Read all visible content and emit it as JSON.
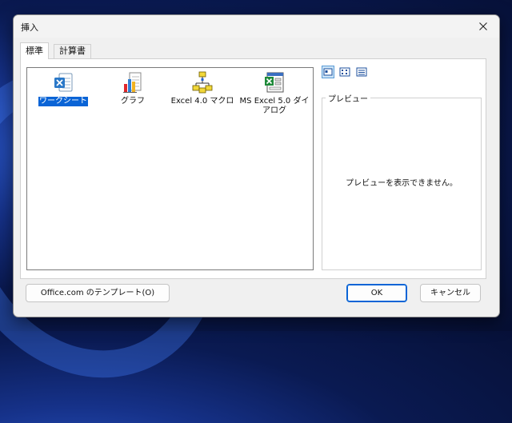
{
  "dialog": {
    "title": "挿入",
    "close_icon": "close-icon"
  },
  "tabs": [
    {
      "label": "標準",
      "active": true
    },
    {
      "label": "計算書",
      "active": false
    }
  ],
  "templates": [
    {
      "label": "ワークシート",
      "icon": "excel-worksheet-icon",
      "selected": true
    },
    {
      "label": "グラフ",
      "icon": "chart-icon",
      "selected": false
    },
    {
      "label": "Excel 4.0 マクロ",
      "icon": "macro-sheet-icon",
      "selected": false
    },
    {
      "label": "MS Excel 5.0 ダイアログ",
      "icon": "dialog-sheet-icon",
      "selected": false
    }
  ],
  "view_buttons": [
    {
      "icon": "large-icons-view-icon",
      "active": true
    },
    {
      "icon": "list-view-icon",
      "active": false
    },
    {
      "icon": "details-view-icon",
      "active": false
    }
  ],
  "preview": {
    "legend": "プレビュー",
    "message": "プレビューを表示できません。"
  },
  "buttons": {
    "office_templates": "Office.com のテンプレート(O)",
    "ok": "OK",
    "cancel": "キャンセル"
  },
  "colors": {
    "selection": "#0a64d6",
    "accent": "#0a64d6",
    "dialog_bg": "#f0f0f0"
  }
}
